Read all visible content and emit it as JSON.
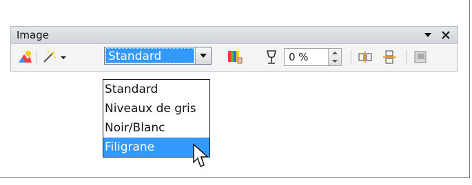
{
  "window": {
    "title": "Image",
    "menu_icon": "dropdown-arrow-icon",
    "close_icon": "close-icon"
  },
  "toolbar": {
    "image_icon": "image-icon",
    "magic_wand_icon": "magic-wand-icon",
    "graphics_mode": {
      "selected": "Standard",
      "options": [
        "Standard",
        "Niveaux de gris",
        "Noir/Blanc",
        "Filigrane"
      ],
      "highlighted": "Filigrane"
    },
    "color_icon": "color-icon",
    "transparency_icon": "transparency-icon",
    "transparency_value": "0 %",
    "flip_vertical_icon": "flip-vertical-icon",
    "flip_horizontal_icon": "flip-horizontal-icon",
    "crop_icon": "crop-icon"
  },
  "colors": {
    "selection": "#3399ff",
    "text": "#111111"
  }
}
